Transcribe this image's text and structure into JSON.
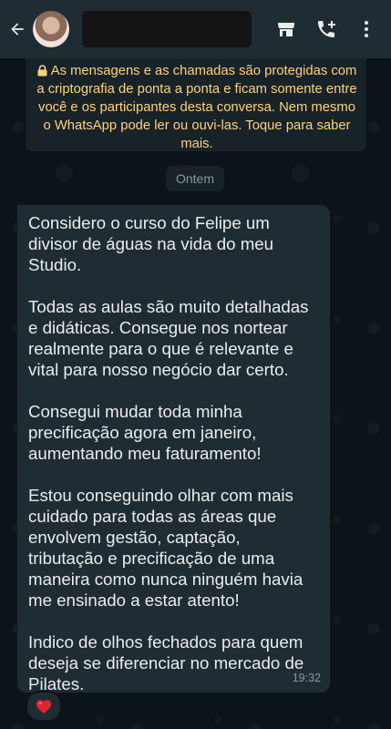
{
  "encryption_notice": "As mensagens e as chamadas são protegidas com a criptografia de ponta a ponta e ficam somente entre você e os participantes desta conversa. Nem mesmo o WhatsApp pode ler ou ouvi-las. Toque para saber mais.",
  "date_divider": "Ontem",
  "message": {
    "paragraphs": [
      "Considero o curso do Felipe um divisor de águas na vida do meu Studio.",
      "Todas as aulas são muito detalhadas e didáticas. Consegue nos nortear realmente para o que é relevante e vital para nosso negócio dar certo.",
      "Consegui mudar toda minha precificação agora em janeiro, aumentando meu faturamento!",
      "Estou conseguindo olhar com mais cuidado para todas as áreas que envolvem gestão, captação, tributação e precificação de uma maneira como nunca ninguém havia me ensinado a estar atento!",
      "Indico de olhos fechados para quem deseja se diferenciar no mercado de Pilates."
    ],
    "time": "19:32",
    "reaction": "heart-emoji"
  },
  "icons": {
    "back": "arrow-left-icon",
    "store": "store-icon",
    "call_add": "add-call-icon",
    "menu": "more-vert-icon",
    "lock": "lock-icon"
  },
  "colors": {
    "header": "#1f2c34",
    "background": "#0b141a",
    "bubble": "#202c33",
    "notice_text": "#ffd279",
    "meta_text": "#8696a0"
  }
}
